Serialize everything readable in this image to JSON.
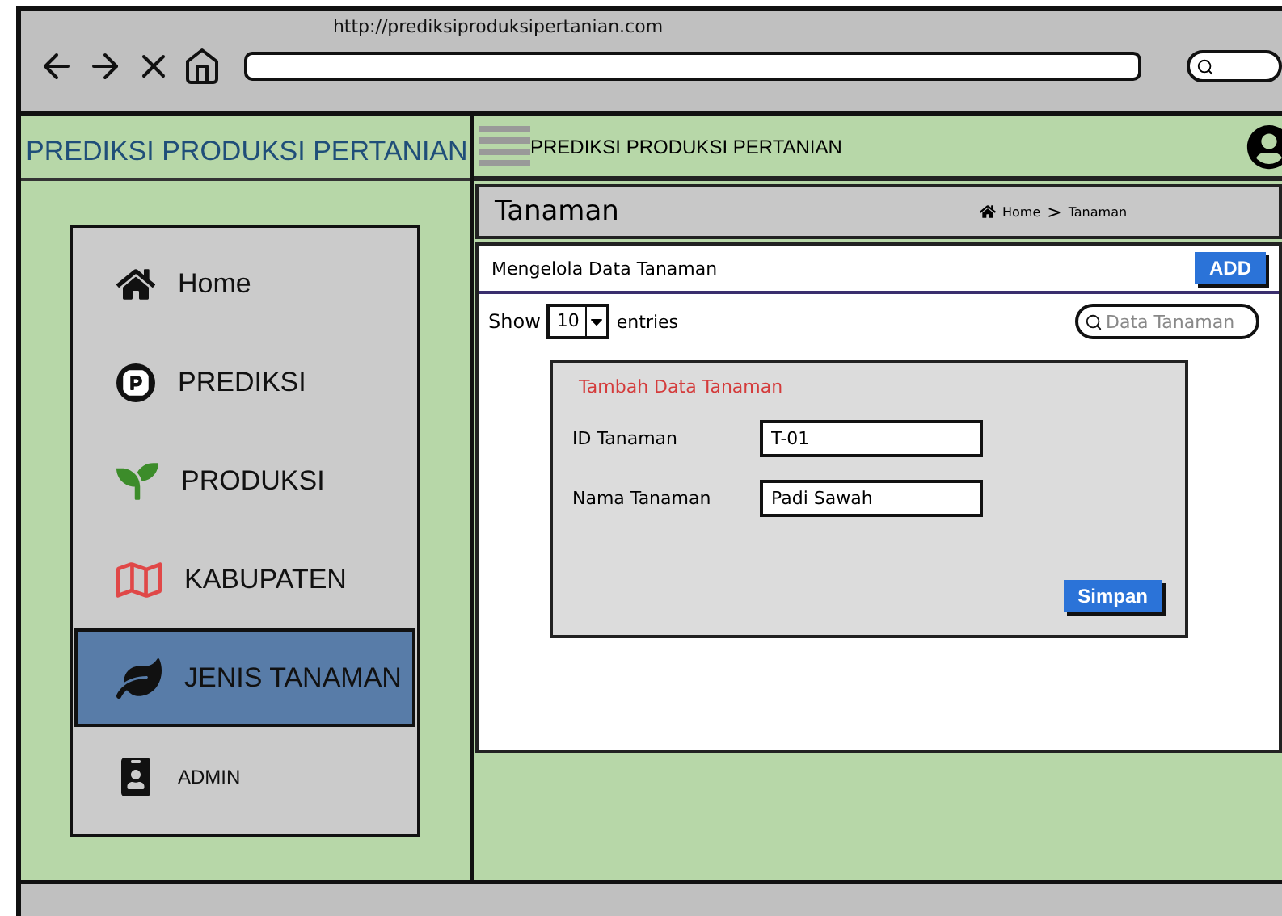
{
  "browser": {
    "url": "http://prediksiproduksipertanian.com"
  },
  "sidebar": {
    "title": "PREDIKSI PRODUKSI PERTANIAN",
    "items": [
      {
        "label": "Home",
        "kind": "home",
        "selected": false
      },
      {
        "label": "PREDIKSI",
        "kind": "prediksi",
        "selected": false
      },
      {
        "label": "PRODUKSI",
        "kind": "produksi",
        "selected": false
      },
      {
        "label": "KABUPATEN",
        "kind": "kabupaten",
        "selected": false
      },
      {
        "label": "JENIS TANAMAN",
        "kind": "tanaman",
        "selected": true
      },
      {
        "label": "ADMIN",
        "kind": "admin",
        "selected": false
      }
    ]
  },
  "topbar": {
    "title": "PREDIKSI PRODUKSI PERTANIAN"
  },
  "page": {
    "title": "Tanaman",
    "breadcrumb": [
      "Home",
      "Tanaman"
    ],
    "separator": ">"
  },
  "card": {
    "title": "Mengelola Data Tanaman",
    "add_button": "ADD",
    "show_label": "Show",
    "entries_value": "10",
    "entries_label": "entries",
    "search_placeholder": "Data Tanaman"
  },
  "form": {
    "title": "Tambah Data Tanaman",
    "fields": [
      {
        "label": "ID Tanaman",
        "value": "T-01"
      },
      {
        "label": "Nama Tanaman",
        "value": "Padi Sawah"
      }
    ],
    "submit": "Simpan"
  }
}
